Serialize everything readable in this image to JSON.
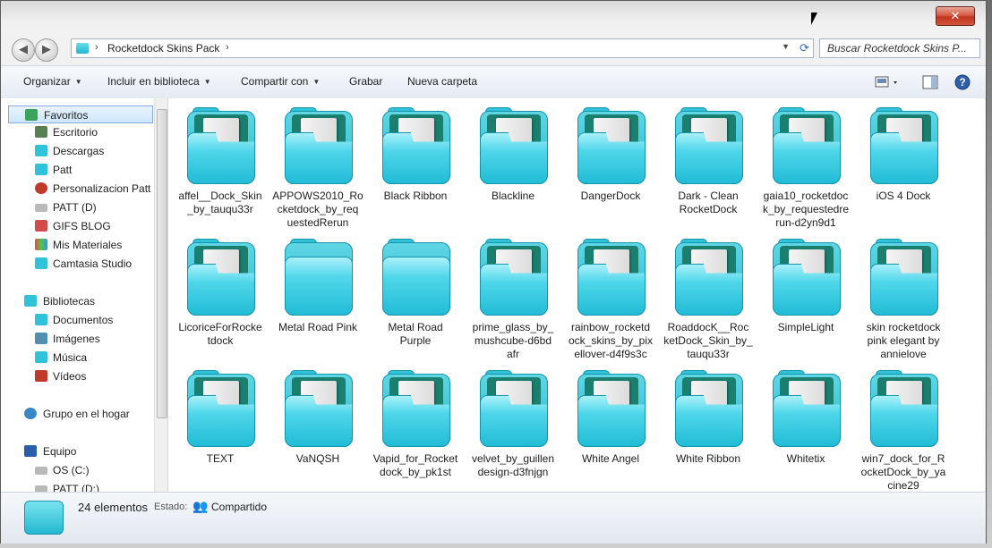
{
  "window": {
    "close_label": "✕"
  },
  "address": {
    "sep1": "›",
    "crumb": "Rocketdock Skins Pack",
    "sep2": "›",
    "dropdown": "▼",
    "refresh": "⟳"
  },
  "search": {
    "placeholder": "Buscar Rocketdock Skins P..."
  },
  "toolbar": {
    "organize": "Organizar",
    "include": "Incluir en biblioteca",
    "share": "Compartir con",
    "burn": "Grabar",
    "new_folder": "Nueva carpeta"
  },
  "sidebar": {
    "favorites_header": "Favoritos",
    "favorites": [
      "Escritorio",
      "Descargas",
      "Patt",
      "Personalizacion Patt",
      "PATT (D)",
      "GIFS BLOG",
      "Mis Materiales",
      "Camtasia Studio"
    ],
    "libraries_header": "Bibliotecas",
    "libraries": [
      "Documentos",
      "Imágenes",
      "Música",
      "Vídeos"
    ],
    "homegroup": "Grupo en el hogar",
    "computer_header": "Equipo",
    "computer": [
      "OS (C:)",
      "PATT (D:)"
    ]
  },
  "items": [
    [
      "affel__Dock_Skin",
      "_by_tauqu33r"
    ],
    [
      "APPOWS2010_Ro",
      "cketdock_by_req",
      "uestedRerun"
    ],
    [
      "Black Ribbon"
    ],
    [
      "Blackline"
    ],
    [
      "DangerDock"
    ],
    [
      "Dark - Clean",
      "RocketDock"
    ],
    [
      "gaia10_rocketdoc",
      "k_by_requestedre",
      "run-d2yn9d1"
    ],
    [
      "iOS 4 Dock"
    ],
    [
      "LicoriceForRocke",
      "tdock"
    ],
    [
      "Metal Road Pink"
    ],
    [
      "Metal Road",
      "Purple"
    ],
    [
      "prime_glass_by_",
      "mushcube-d6bd",
      "afr"
    ],
    [
      "rainbow_rocketd",
      "ock_skins_by_pix",
      "ellover-d4f9s3c"
    ],
    [
      "RoaddocK__Roc",
      "ketDock_Skin_by_",
      "tauqu33r"
    ],
    [
      "SimpleLight"
    ],
    [
      "skin rocketdock",
      "pink elegant by",
      "annielove"
    ],
    [
      "TEXT"
    ],
    [
      "VaNQSH"
    ],
    [
      "Vapid_for_Rocket",
      "dock_by_pk1st"
    ],
    [
      "velvet_by_guillen",
      "design-d3fnjgn"
    ],
    [
      "White Angel"
    ],
    [
      "White Ribbon"
    ],
    [
      "Whitetix"
    ],
    [
      "win7_dock_for_R",
      "ocketDock_by_ya",
      "cine29"
    ]
  ],
  "status": {
    "count": "24 elementos",
    "state_label": "Estado:",
    "state_value": "Compartido"
  },
  "colors": {
    "folder": "#27b9cf",
    "selection": "#cfe6fb"
  }
}
